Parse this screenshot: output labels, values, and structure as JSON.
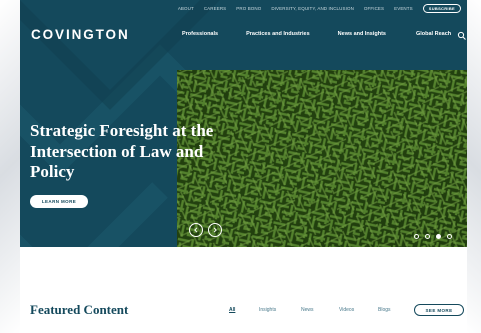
{
  "utility_nav": {
    "items": [
      "ABOUT",
      "CAREERS",
      "PRO BONO",
      "DIVERSITY, EQUITY, AND INCLUSION",
      "OFFICES",
      "EVENTS"
    ],
    "subscribe_label": "SUBSCRIBE"
  },
  "brand": {
    "logo_text": "COVINGTON"
  },
  "main_nav": {
    "items": [
      "Professionals",
      "Practices and Industries",
      "News and Insights",
      "Global Reach"
    ],
    "search_icon": "search-icon"
  },
  "hero": {
    "headline": "Strategic Foresight at the Intersection of Law and Policy",
    "cta_label": "LEARN MORE",
    "prev_icon": "chevron-left-icon",
    "next_icon": "chevron-right-icon",
    "slide_count": 4,
    "active_slide": 3
  },
  "featured": {
    "title": "Featured Content",
    "tabs": [
      "All",
      "Insights",
      "News",
      "Videos",
      "Blogs"
    ],
    "active_tab": "All",
    "see_more_label": "SEE MORE"
  },
  "colors": {
    "hero_bg": "#14495c",
    "accent": "#14495c",
    "link_muted": "#4a7a8c",
    "page_bg": "#ffffff"
  }
}
